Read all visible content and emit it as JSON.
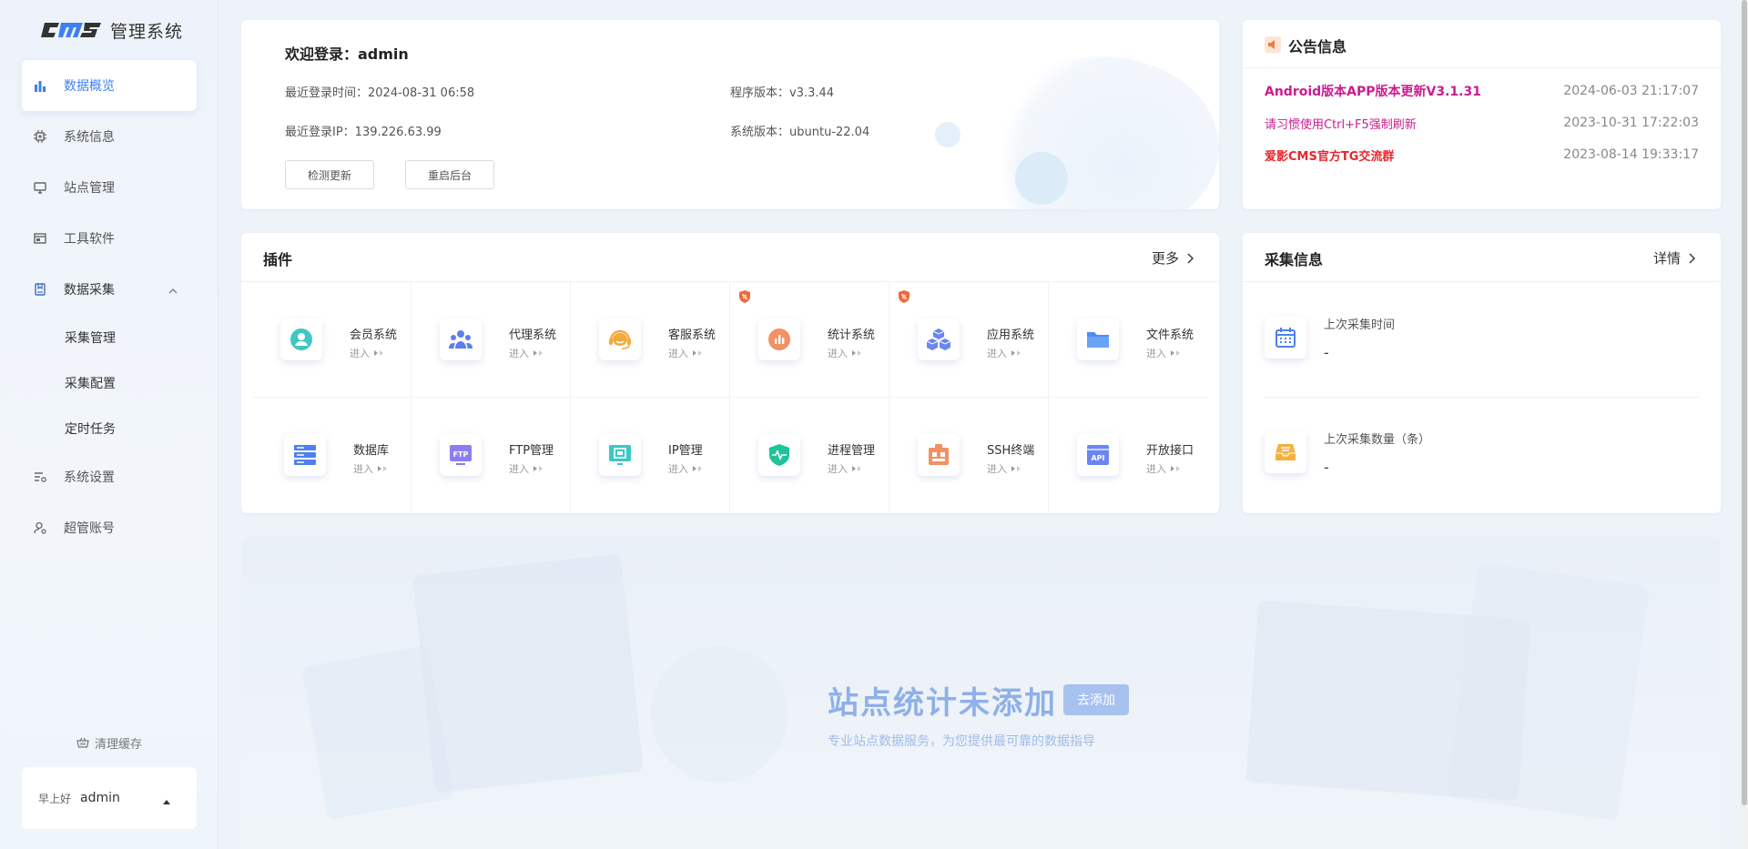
{
  "app": {
    "logo_text": "管理系统"
  },
  "sidebar": {
    "items": [
      {
        "label": "数据概览",
        "icon": "bar-chart-icon",
        "active": true
      },
      {
        "label": "系统信息",
        "icon": "chip-icon"
      },
      {
        "label": "站点管理",
        "icon": "monitor-icon"
      },
      {
        "label": "工具软件",
        "icon": "window-icon"
      },
      {
        "label": "数据采集",
        "icon": "collect-icon",
        "expanded": true
      },
      {
        "label": "系统设置",
        "icon": "settings-list-icon"
      },
      {
        "label": "超管账号",
        "icon": "user-gear-icon"
      }
    ],
    "sub_items": [
      "采集管理",
      "采集配置",
      "定时任务"
    ],
    "clean_cache": "清理缓存",
    "greeting": "早上好",
    "username": "admin"
  },
  "welcome": {
    "title": "欢迎登录：admin",
    "last_login_time": "最近登录时间：2024-08-31 06:58",
    "last_login_ip": "最近登录IP：139.226.63.99",
    "app_version": "程序版本：v3.3.44",
    "sys_version": "系统版本：ubuntu-22.04",
    "check_update": "检测更新",
    "restart": "重启后台"
  },
  "notice": {
    "title": "公告信息",
    "items": [
      {
        "text": "Android版本APP版本更新V3.1.31",
        "date": "2024-06-03 21:17:07",
        "color": "#c81d8f"
      },
      {
        "text": "请习惯使用Ctrl+F5强制刷新",
        "date": "2023-10-31 17:22:03",
        "color": "#c81d8f"
      },
      {
        "text": "爱影CMS官方TG交流群",
        "date": "2023-08-14 19:33:17",
        "color": "#e8262b"
      }
    ]
  },
  "plugins": {
    "title": "插件",
    "more": "更多",
    "enter": "进入",
    "items": [
      {
        "name": "会员系统",
        "icon": "member-icon"
      },
      {
        "name": "代理系统",
        "icon": "agent-icon"
      },
      {
        "name": "客服系统",
        "icon": "headset-icon"
      },
      {
        "name": "统计系统",
        "icon": "stats-icon",
        "badge": true
      },
      {
        "name": "应用系统",
        "icon": "cubes-icon",
        "badge": true
      },
      {
        "name": "文件系统",
        "icon": "folder-icon"
      },
      {
        "name": "数据库",
        "icon": "database-icon"
      },
      {
        "name": "FTP管理",
        "icon": "ftp-icon"
      },
      {
        "name": "IP管理",
        "icon": "ip-icon"
      },
      {
        "name": "进程管理",
        "icon": "shield-pulse-icon"
      },
      {
        "name": "SSH终端",
        "icon": "ssh-icon"
      },
      {
        "name": "开放接口",
        "icon": "api-icon"
      }
    ]
  },
  "collect": {
    "title": "采集信息",
    "details": "详情",
    "last_time_label": "上次采集时间",
    "last_time_value": "-",
    "last_count_label": "上次采集数量（条）",
    "last_count_value": "-"
  },
  "site_stats": {
    "title": "站点统计未添加",
    "add_button": "去添加",
    "subtitle": "专业站点数据服务，为您提供最可靠的数据指导"
  }
}
